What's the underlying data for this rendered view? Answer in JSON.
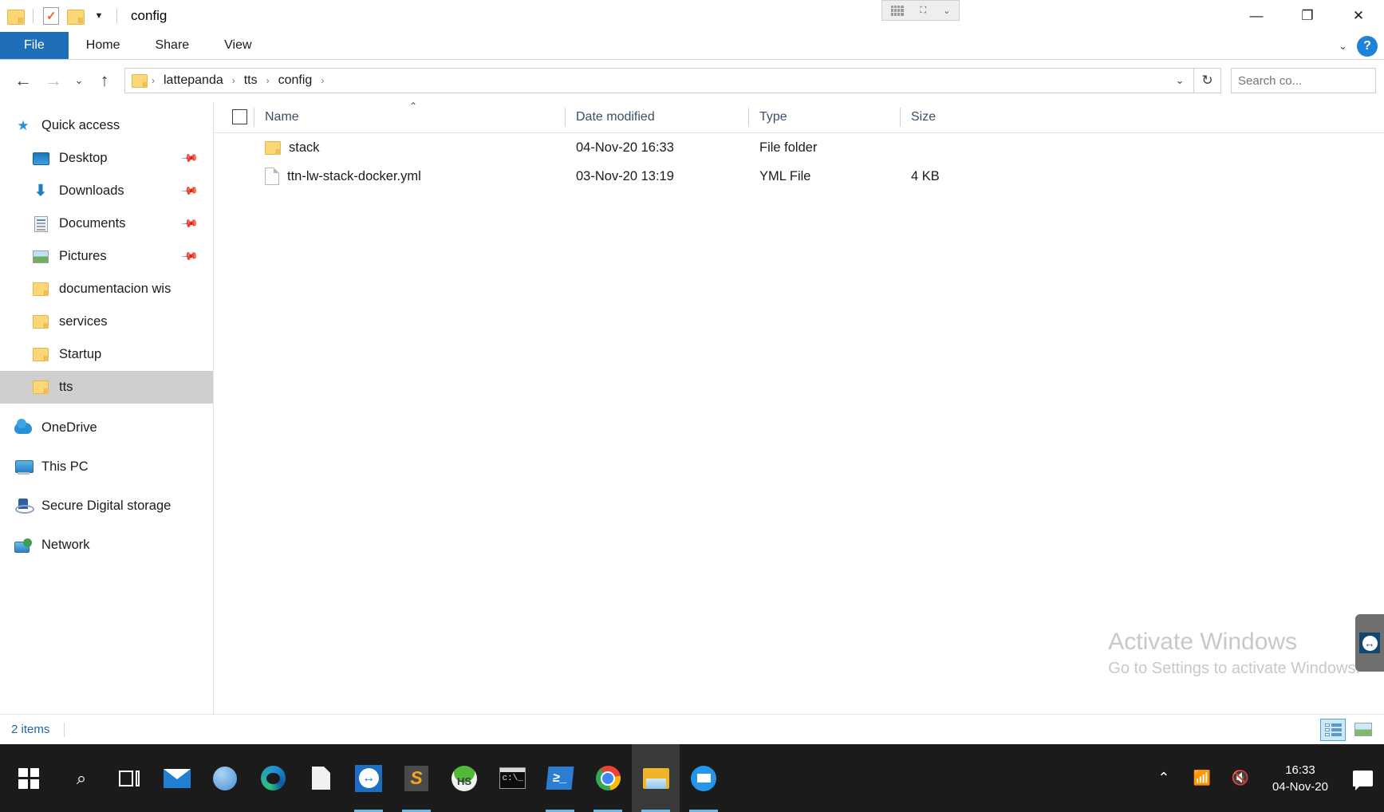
{
  "window": {
    "title": "config",
    "quick_access_toolbar": [
      {
        "name": "properties-icon",
        "glyph": "folder"
      },
      {
        "name": "new-folder-icon",
        "glyph": "doc-check"
      },
      {
        "name": "customize-icon",
        "glyph": "folder"
      },
      {
        "name": "customize-dropdown-icon",
        "glyph": "▼"
      }
    ],
    "controls": {
      "minimize": "—",
      "restore": "❐",
      "close": "✕"
    },
    "overlay_toolbar": {
      "grid": "grid",
      "fullscreen": "⤢",
      "chevron": "⌄"
    }
  },
  "ribbon": {
    "tabs": [
      {
        "label": "File",
        "active": true
      },
      {
        "label": "Home",
        "active": false
      },
      {
        "label": "Share",
        "active": false
      },
      {
        "label": "View",
        "active": false
      }
    ],
    "expand_chevron": "⌄",
    "help_label": "?"
  },
  "address_bar": {
    "back": "←",
    "forward": "→",
    "recent": "⌄",
    "up": "↑",
    "breadcrumb": [
      "lattepanda",
      "tts",
      "config"
    ],
    "breadcrumb_separator": "›",
    "dropdown": "⌄",
    "refresh": "↻"
  },
  "search": {
    "value": "",
    "placeholder": "Search co...",
    "icon": "search-icon"
  },
  "sidebar": {
    "groups": [
      {
        "name": "Quick access",
        "icon": "star-icon",
        "items": [
          {
            "label": "Desktop",
            "icon": "desktop-icon",
            "pinned": true
          },
          {
            "label": "Downloads",
            "icon": "download-icon",
            "pinned": true
          },
          {
            "label": "Documents",
            "icon": "documents-icon",
            "pinned": true
          },
          {
            "label": "Pictures",
            "icon": "pictures-icon",
            "pinned": true
          },
          {
            "label": "documentacion wis",
            "icon": "folder-icon",
            "pinned": false
          },
          {
            "label": "services",
            "icon": "folder-icon",
            "pinned": false
          },
          {
            "label": "Startup",
            "icon": "folder-icon",
            "pinned": false
          },
          {
            "label": "tts",
            "icon": "folder-icon",
            "pinned": false,
            "selected": true
          }
        ]
      },
      {
        "name": "OneDrive",
        "icon": "onedrive-icon",
        "items": []
      },
      {
        "name": "This PC",
        "icon": "this-pc-icon",
        "items": []
      },
      {
        "name": "Secure Digital storage",
        "icon": "sd-storage-icon",
        "items": []
      },
      {
        "name": "Network",
        "icon": "network-icon",
        "items": []
      }
    ]
  },
  "file_list": {
    "columns": [
      {
        "label": "Name",
        "sorted": "asc",
        "sort_glyph": "⌃"
      },
      {
        "label": "Date modified"
      },
      {
        "label": "Type"
      },
      {
        "label": "Size"
      }
    ],
    "rows": [
      {
        "name": "stack",
        "date_modified": "04-Nov-20 16:33",
        "type": "File folder",
        "size": "",
        "icon": "folder-icon"
      },
      {
        "name": "ttn-lw-stack-docker.yml",
        "date_modified": "03-Nov-20 13:19",
        "type": "YML File",
        "size": "4 KB",
        "icon": "yml-file-icon"
      }
    ]
  },
  "watermark": {
    "title": "Activate Windows",
    "subtitle": "Go to Settings to activate Windows."
  },
  "status_bar": {
    "item_count": "2 items",
    "views": [
      {
        "name": "details-view",
        "active": true
      },
      {
        "name": "large-icons-view",
        "active": false
      }
    ]
  },
  "teamviewer_tab": {
    "label": "↔"
  },
  "taskbar": {
    "items": [
      {
        "name": "start-button",
        "icon": "windows-logo-icon"
      },
      {
        "name": "search-button",
        "icon": "search-icon",
        "glyph": "⌕"
      },
      {
        "name": "task-view-button",
        "icon": "task-view-icon"
      },
      {
        "name": "mail-app",
        "icon": "mail-icon"
      },
      {
        "name": "sphere-app",
        "icon": "sphere-icon"
      },
      {
        "name": "edge-browser",
        "icon": "edge-icon"
      },
      {
        "name": "notepad-app",
        "icon": "document-icon"
      },
      {
        "name": "teamviewer-app",
        "icon": "teamviewer-icon",
        "glyph": "↔",
        "running": true
      },
      {
        "name": "sublime-text-app",
        "icon": "sublime-icon",
        "glyph": "S",
        "running": true
      },
      {
        "name": "heidisql-app",
        "icon": "heidisql-icon",
        "glyph": "HS"
      },
      {
        "name": "command-prompt-app",
        "icon": "cmd-icon"
      },
      {
        "name": "powershell-app",
        "icon": "powershell-icon",
        "glyph": "≥_",
        "running": true
      },
      {
        "name": "chrome-browser",
        "icon": "chrome-icon",
        "running": true
      },
      {
        "name": "file-explorer-app",
        "icon": "file-explorer-icon",
        "active": true,
        "running": true
      },
      {
        "name": "docker-app",
        "icon": "docker-icon",
        "running": true
      }
    ],
    "tray": {
      "show_hidden": "⌃",
      "network": "network-icon",
      "volume": "volume-muted-icon",
      "time": "16:33",
      "date": "04-Nov-20",
      "action_center": "action-center-icon"
    }
  }
}
